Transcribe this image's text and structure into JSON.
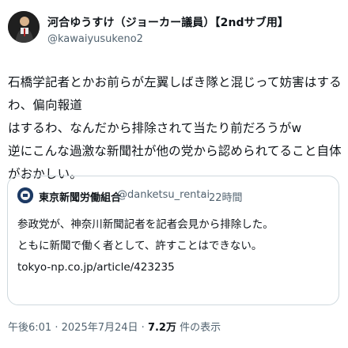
{
  "author": {
    "display_name": "河合ゆうすけ（ジョーカー議員）【2ndサブ用】",
    "handle": "@kawaiyusukeno2"
  },
  "post": {
    "text": "石橋学記者とかお前らが左翼しばき隊と混じって妨害はするわ、偏向報道\nはするわ、なんだから排除されて当たり前だろうがw\n逆にこんな過激な新聞社が他の党から認められてること自体がおかしい。"
  },
  "quoted_post": {
    "display_name": "東京新聞労働組合",
    "handle": "@danketsu_rentai",
    "separator": "·",
    "time": "22時間",
    "text": "参政党が、神奈川新聞記者を記者会見から排除した。\nともに新聞で働く者として、許すことはできない。\ntokyo-np.co.jp/article/423235"
  },
  "meta": {
    "time": "午後6:01",
    "separator": "·",
    "date": "2025年7月24日",
    "views_count": "7.2万",
    "views_label": "件の表示"
  }
}
